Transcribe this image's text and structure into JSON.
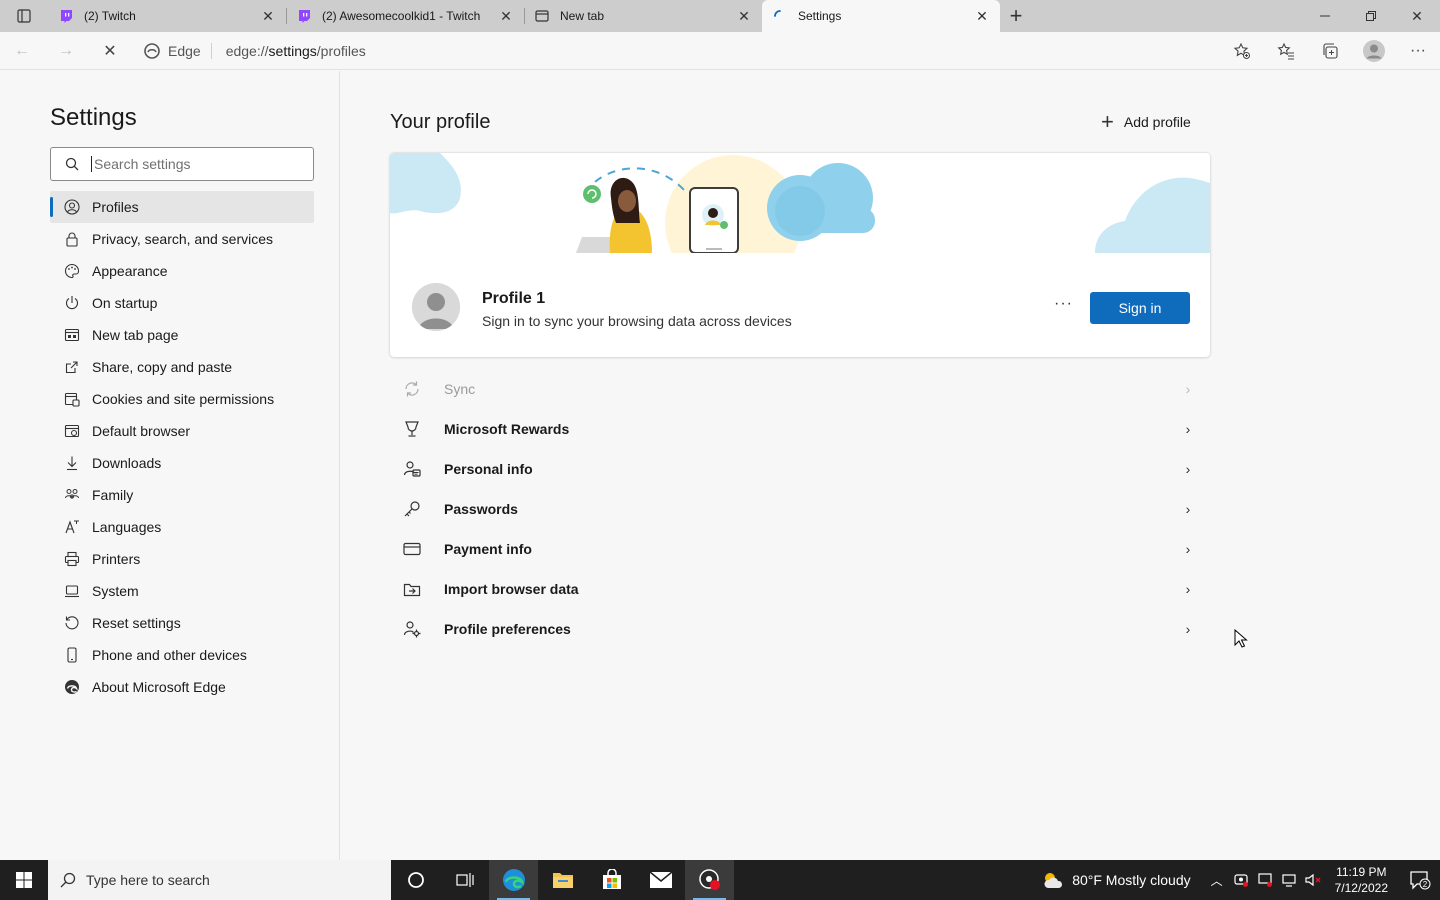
{
  "browser": {
    "tabs": [
      {
        "title": "(2) Twitch",
        "favicon": "twitch-icon",
        "active": false
      },
      {
        "title": "(2) Awesomecoolkid1 - Twitch",
        "favicon": "twitch-icon",
        "active": false
      },
      {
        "title": "New tab",
        "favicon": "newtab-icon",
        "active": false
      },
      {
        "title": "Settings",
        "favicon": "loading-icon",
        "active": true
      }
    ],
    "address": {
      "chip": "Edge",
      "url_prefix": "edge://",
      "url_host": "settings",
      "url_path": "/profiles"
    }
  },
  "sidebar": {
    "title": "Settings",
    "search_placeholder": "Search settings",
    "items": [
      {
        "label": "Profiles",
        "icon": "profile-icon",
        "active": true
      },
      {
        "label": "Privacy, search, and services",
        "icon": "lock-icon"
      },
      {
        "label": "Appearance",
        "icon": "appearance-icon"
      },
      {
        "label": "On startup",
        "icon": "power-icon"
      },
      {
        "label": "New tab page",
        "icon": "newtab-page-icon"
      },
      {
        "label": "Share, copy and paste",
        "icon": "share-icon"
      },
      {
        "label": "Cookies and site permissions",
        "icon": "cookies-icon"
      },
      {
        "label": "Default browser",
        "icon": "default-browser-icon"
      },
      {
        "label": "Downloads",
        "icon": "download-icon"
      },
      {
        "label": "Family",
        "icon": "family-icon"
      },
      {
        "label": "Languages",
        "icon": "languages-icon"
      },
      {
        "label": "Printers",
        "icon": "printer-icon"
      },
      {
        "label": "System",
        "icon": "system-icon"
      },
      {
        "label": "Reset settings",
        "icon": "reset-icon"
      },
      {
        "label": "Phone and other devices",
        "icon": "phone-icon"
      },
      {
        "label": "About Microsoft Edge",
        "icon": "edge-logo-icon"
      }
    ]
  },
  "main": {
    "heading": "Your profile",
    "add_profile": "Add profile",
    "profile": {
      "name": "Profile 1",
      "description": "Sign in to sync your browsing data across devices",
      "more": "···",
      "sign_in": "Sign in"
    },
    "rows": [
      {
        "label": "Sync",
        "icon": "sync-icon",
        "disabled": true
      },
      {
        "label": "Microsoft Rewards",
        "icon": "rewards-icon"
      },
      {
        "label": "Personal info",
        "icon": "personal-info-icon"
      },
      {
        "label": "Passwords",
        "icon": "key-icon"
      },
      {
        "label": "Payment info",
        "icon": "card-icon"
      },
      {
        "label": "Import browser data",
        "icon": "import-icon"
      },
      {
        "label": "Profile preferences",
        "icon": "profile-prefs-icon"
      }
    ]
  },
  "taskbar": {
    "search_placeholder": "Type here to search",
    "weather": "80°F  Mostly cloudy",
    "time": "11:19 PM",
    "date": "7/12/2022",
    "notification_count": "2"
  },
  "colors": {
    "accent": "#0f6cbd",
    "twitch": "#9146ff"
  }
}
